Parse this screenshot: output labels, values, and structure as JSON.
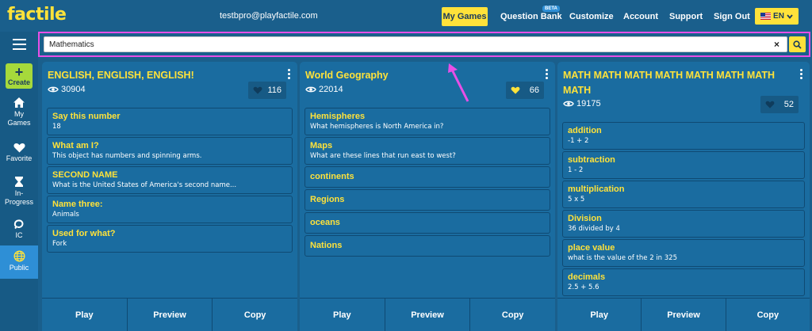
{
  "brand": {
    "logo": "factile"
  },
  "header": {
    "email": "testbpro@playfactile.com",
    "nav": {
      "my_games": "My Games",
      "question_bank": "Question Bank",
      "beta": "BETA",
      "customize": "Customize",
      "account": "Account",
      "support": "Support",
      "sign_out": "Sign Out",
      "language": "EN"
    }
  },
  "sidebar": {
    "create": "Create",
    "items": [
      {
        "label": "My Games",
        "icon": "home-icon"
      },
      {
        "label": "Favorite",
        "icon": "heart-icon"
      },
      {
        "label": "In-Progress",
        "icon": "hourglass-icon"
      },
      {
        "label": "IC",
        "icon": "loop-icon"
      },
      {
        "label": "Public",
        "icon": "globe-icon",
        "active": true
      }
    ]
  },
  "search": {
    "value": "Mathematics",
    "clear": "×"
  },
  "cards": [
    {
      "title": "ENGLISH, ENGLISH, ENGLISH!",
      "views": "30904",
      "likes": "116",
      "liked": false,
      "questions": [
        {
          "title": "Say this number",
          "sub": "18"
        },
        {
          "title": "What am I?",
          "sub": "This object has numbers and spinning arms."
        },
        {
          "title": "SECOND NAME",
          "sub": "What is the United States of America's second name..."
        },
        {
          "title": "Name three:",
          "sub": "Animals"
        },
        {
          "title": "Used for what?",
          "sub": "Fork"
        }
      ],
      "actions": [
        "Play",
        "Preview",
        "Copy"
      ]
    },
    {
      "title": "World Geography",
      "views": "22014",
      "likes": "66",
      "liked": true,
      "questions": [
        {
          "title": "Hemispheres",
          "sub": "What hemispheres is North America in?"
        },
        {
          "title": "Maps",
          "sub": "What are these lines that run east to west?"
        },
        {
          "title": "continents",
          "sub": ""
        },
        {
          "title": "Regions",
          "sub": ""
        },
        {
          "title": "oceans",
          "sub": ""
        },
        {
          "title": "Nations",
          "sub": ""
        }
      ],
      "actions": [
        "Play",
        "Preview",
        "Copy"
      ]
    },
    {
      "title": "MATH MATH MATH MATH MATH MATH MATH MATH",
      "views": "19175",
      "likes": "52",
      "liked": false,
      "questions": [
        {
          "title": "addition",
          "sub": "-1 + 2"
        },
        {
          "title": "subtraction",
          "sub": "1 - 2"
        },
        {
          "title": "multiplication",
          "sub": "5 x 5"
        },
        {
          "title": "Division",
          "sub": "36 divided by 4"
        },
        {
          "title": "place value",
          "sub": "what is the value of the 2 in 325"
        },
        {
          "title": "decimals",
          "sub": "2.5 + 5.6"
        }
      ],
      "actions": [
        "Play",
        "Preview",
        "Copy"
      ]
    }
  ],
  "colors": {
    "background": "#1a5f8c",
    "card": "#1a6ca0",
    "accent_yellow": "#ffe23a",
    "create_green": "#a6d93b",
    "annotation_magenta": "#e84fe6",
    "active_blue": "#2e8fd6"
  }
}
